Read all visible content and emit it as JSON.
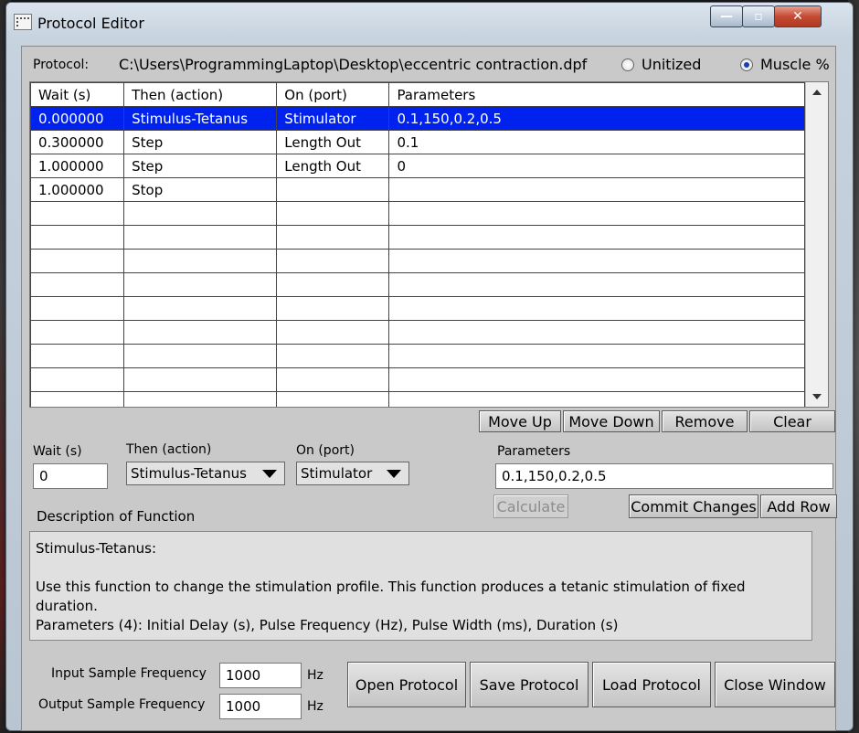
{
  "window": {
    "title": "Protocol Editor",
    "controls": {
      "minimize": "—",
      "maximize": "▫",
      "close": "✕"
    }
  },
  "protocol": {
    "label": "Protocol:",
    "path": "C:\\Users\\ProgrammingLaptop\\Desktop\\eccentric contraction.dpf",
    "unit_options": [
      "Unitized",
      "Muscle %"
    ],
    "selected_unit": "Muscle %"
  },
  "table": {
    "columns": [
      "Wait (s)",
      "Then (action)",
      "On (port)",
      "Parameters"
    ],
    "rows": [
      [
        "0.000000",
        "Stimulus-Tetanus",
        "Stimulator",
        "0.1,150,0.2,0.5"
      ],
      [
        "0.300000",
        "Step",
        "Length Out",
        "0.1"
      ],
      [
        "1.000000",
        "Step",
        "Length Out",
        "0"
      ],
      [
        "1.000000",
        "Stop",
        "",
        ""
      ]
    ],
    "selected_row": 0,
    "empty_rows": 9
  },
  "row_buttons": {
    "move_up": "Move Up",
    "move_down": "Move Down",
    "remove": "Remove",
    "clear": "Clear"
  },
  "editor": {
    "wait_label": "Wait (s)",
    "wait_value": "0",
    "action_label": "Then (action)",
    "action_value": "Stimulus-Tetanus",
    "port_label": "On (port)",
    "port_value": "Stimulator",
    "params_label": "Parameters",
    "params_value": "0.1,150,0.2,0.5",
    "calculate": "Calculate",
    "commit": "Commit Changes",
    "add_row": "Add Row"
  },
  "description": {
    "label": "Description of Function",
    "title": "Stimulus-Tetanus:",
    "body": "Use this function to change the stimulation profile.  This function produces a tetanic stimulation of fixed duration.",
    "params": "Parameters (4): Initial Delay (s), Pulse Frequency (Hz), Pulse Width (ms), Duration (s)"
  },
  "sampling": {
    "input_label": "Input Sample Frequency",
    "input_value": "1000",
    "output_label": "Output Sample Frequency",
    "output_value": "1000",
    "unit": "Hz"
  },
  "file_buttons": {
    "open": "Open Protocol",
    "save": "Save Protocol",
    "load": "Load Protocol",
    "close": "Close Window"
  }
}
